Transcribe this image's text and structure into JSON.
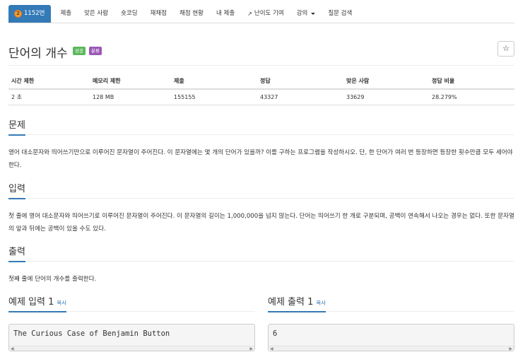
{
  "nav": {
    "problem_number": "1152번",
    "tabs": [
      "제출",
      "맞은 사람",
      "숏코딩",
      "재채점",
      "채점 현황",
      "내 제출",
      "난이도 기여",
      "강의",
      "질문 검색"
    ]
  },
  "problem": {
    "title": "단어의 개수",
    "label_success": "성공",
    "label_info": "분류",
    "star": "☆"
  },
  "stats": {
    "headers": [
      "시간 제한",
      "메모리 제한",
      "제출",
      "정답",
      "맞은 사람",
      "정답 비율"
    ],
    "values": [
      "2 초",
      "128 MB",
      "155155",
      "43327",
      "33629",
      "28.279%"
    ]
  },
  "sections": {
    "problem_head": "문제",
    "problem_text": "영어 대소문자와 띄어쓰기만으로 이루어진 문자열이 주어진다. 이 문자열에는 몇 개의 단어가 있을까? 이를 구하는 프로그램을 작성하시오. 단, 한 단어가 여러 번 등장하면 등장한 횟수만큼 모두 세어야 한다.",
    "input_head": "입력",
    "input_text": "첫 줄에 영어 대소문자와 띄어쓰기로 이루어진 문자열이 주어진다. 이 문자열의 길이는 1,000,000을 넘지 않는다. 단어는 띄어쓰기 한 개로 구분되며, 공백이 연속해서 나오는 경우는 없다. 또한 문자열의 앞과 뒤에는 공백이 있을 수도 있다.",
    "output_head": "출력",
    "output_text": "첫째 줄에 단어의 개수를 출력한다."
  },
  "samples": {
    "input_head": "예제 입력 1",
    "output_head": "예제 출력 1",
    "copy_label": "복사",
    "input_value": "The Curious Case of Benjamin Button",
    "output_value": "6"
  }
}
